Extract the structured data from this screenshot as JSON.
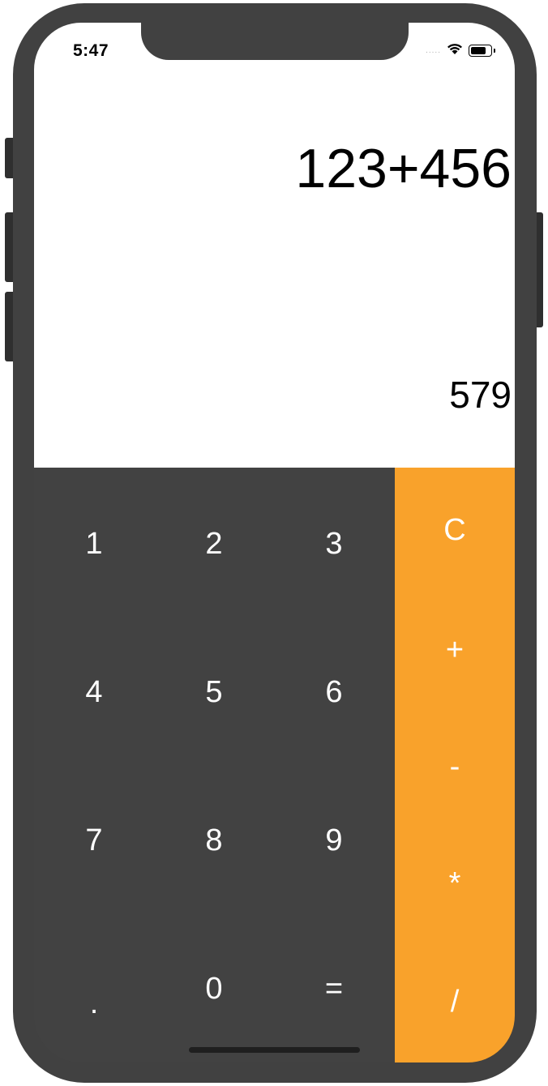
{
  "status": {
    "time": "5:47",
    "signal": ".....",
    "wifi_icon": "wifi-icon",
    "battery_icon": "battery-icon"
  },
  "display": {
    "expression": "123+456",
    "result": "579"
  },
  "keys": {
    "row1": [
      "1",
      "2",
      "3"
    ],
    "row2": [
      "4",
      "5",
      "6"
    ],
    "row3": [
      "7",
      "8",
      "9"
    ],
    "row4": [
      ".",
      "0",
      "="
    ]
  },
  "operators": {
    "clear": "C",
    "add": "+",
    "subtract": "-",
    "multiply": "*",
    "divide": "/"
  },
  "colors": {
    "keypad": "#424242",
    "operator_column": "#f9a22b",
    "display": "#ffffff",
    "phone_frame": "#414141"
  }
}
